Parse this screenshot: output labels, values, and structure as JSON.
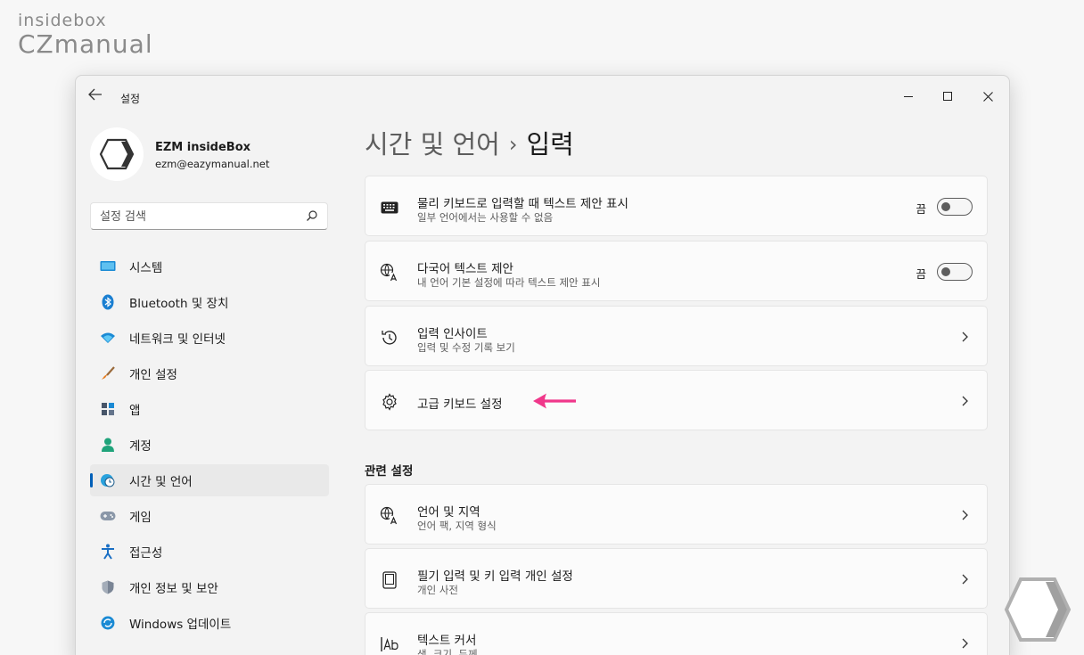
{
  "watermark": {
    "line1": "insidebox",
    "line2": "CZmanual"
  },
  "window": {
    "title": "설정",
    "minimize": "minimize",
    "maximize": "maximize",
    "close": "close"
  },
  "profile": {
    "name": "EZM insideBox",
    "email": "ezm@eazymanual.net"
  },
  "search": {
    "placeholder": "설정 검색"
  },
  "nav": {
    "items": [
      {
        "label": "시스템",
        "icon": "monitor-icon",
        "active": false
      },
      {
        "label": "Bluetooth 및 장치",
        "icon": "bluetooth-icon",
        "active": false
      },
      {
        "label": "네트워크 및 인터넷",
        "icon": "wifi-icon",
        "active": false
      },
      {
        "label": "개인 설정",
        "icon": "brush-icon",
        "active": false
      },
      {
        "label": "앱",
        "icon": "apps-icon",
        "active": false
      },
      {
        "label": "계정",
        "icon": "person-icon",
        "active": false
      },
      {
        "label": "시간 및 언어",
        "icon": "globe-clock-icon",
        "active": true
      },
      {
        "label": "게임",
        "icon": "gamepad-icon",
        "active": false
      },
      {
        "label": "접근성",
        "icon": "accessibility-icon",
        "active": false
      },
      {
        "label": "개인 정보 및 보안",
        "icon": "shield-icon",
        "active": false
      },
      {
        "label": "Windows 업데이트",
        "icon": "update-icon",
        "active": false
      }
    ]
  },
  "header": {
    "parent": "시간 및 언어",
    "separator": "›",
    "current": "입력"
  },
  "cards": [
    {
      "title": "물리 키보드로 입력할 때 텍스트 제안 표시",
      "subtitle": "일부 언어에서는 사용할 수 없음",
      "icon": "keyboard-icon",
      "state": "끔"
    },
    {
      "title": "다국어 텍스트 제안",
      "subtitle": "내 언어 기본 설정에 따라 텍스트 제안 표시",
      "icon": "language-icon",
      "state": "끔"
    },
    {
      "title": "입력 인사이트",
      "subtitle": "입력 및 수정 기록 보기",
      "icon": "history-icon"
    },
    {
      "title": "고급 키보드 설정",
      "icon": "gear-icon"
    }
  ],
  "related": {
    "title": "관련 설정",
    "cards": [
      {
        "title": "언어 및 지역",
        "subtitle": "언어 팩, 지역 형식",
        "icon": "language-icon"
      },
      {
        "title": "필기 입력 및 키 입력 개인 설정",
        "subtitle": "개인 사전",
        "icon": "tablet-icon"
      },
      {
        "title": "텍스트 커서",
        "subtitle": "색, 크기, 두께",
        "icon": "text-cursor-icon"
      }
    ]
  },
  "colors": {
    "accent": "#005fb8",
    "annotation_arrow": "#f0378a",
    "window_bg": "#f3f3f3",
    "card_bg": "#fbfbfb"
  }
}
